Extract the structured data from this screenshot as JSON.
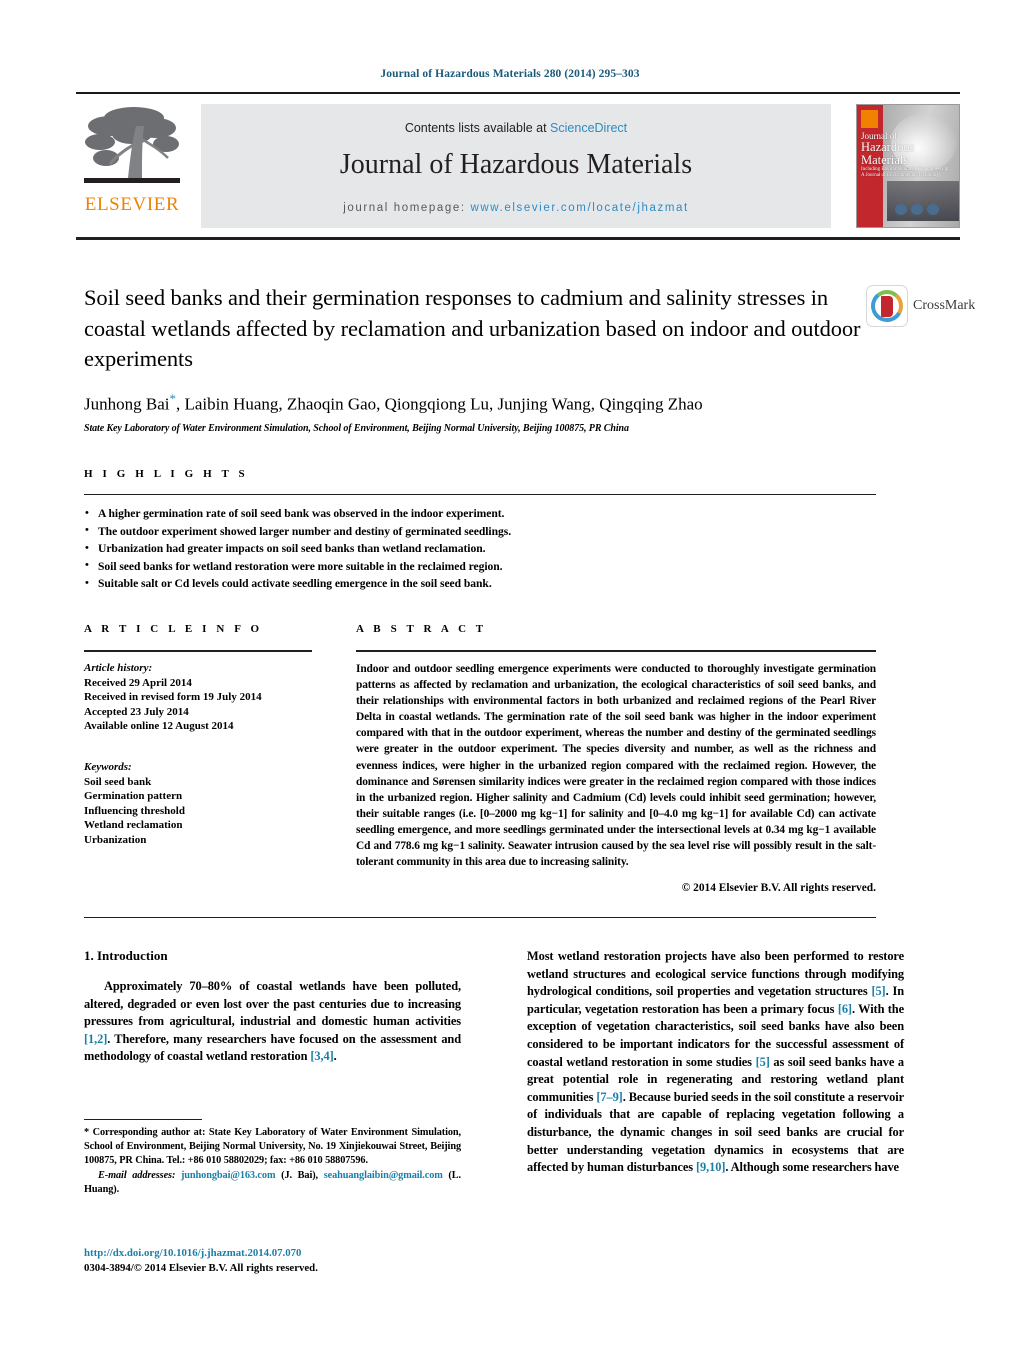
{
  "running_head": "Journal of Hazardous Materials 280 (2014) 295–303",
  "masthead": {
    "contents_prefix": "Contents lists available at ",
    "sciencedirect": "ScienceDirect",
    "journal_title": "Journal of Hazardous Materials",
    "homepage_label": "journal homepage:",
    "homepage_url": "www.elsevier.com/locate/jhazmat",
    "publisher_logo_text": "ELSEVIER",
    "cover_title_line1": "Journal of",
    "cover_title_line2": "Hazardous",
    "cover_title_line3": "Materials",
    "cover_subtitle": "Including Environmental & Bioengineering",
    "cover_subtitle2": "A Journal of Environmental Technology",
    "accent_blue": "#2e8bc4",
    "accent_orange": "#ef8200",
    "band_gray": "#e6e7e8"
  },
  "article": {
    "title": "Soil seed banks and their germination responses to cadmium and salinity stresses in coastal wetlands affected by reclamation and urbanization based on indoor and outdoor experiments",
    "authors": "Junhong Bai",
    "authors_rest": ", Laibin Huang, Zhaoqin Gao, Qiongqiong Lu, Junjing Wang, Qingqing Zhao",
    "corresponding_marker": "*",
    "affiliation": "State Key Laboratory of Water Environment Simulation, School of Environment, Beijing Normal University, Beijing 100875, PR China",
    "crossmark_label": "CrossMark"
  },
  "highlights": {
    "heading": "H I G H L I G H T S",
    "items": [
      "A higher germination rate of soil seed bank was observed in the indoor experiment.",
      "The outdoor experiment showed larger number and destiny of germinated seedlings.",
      "Urbanization had greater impacts on soil seed banks than wetland reclamation.",
      "Soil seed banks for wetland restoration were more suitable in the reclaimed region.",
      "Suitable salt or Cd levels could activate seedling emergence in the soil seed bank."
    ]
  },
  "article_info": {
    "heading": "A R T I C L E    I N F O",
    "history_label": "Article history:",
    "history": [
      "Received 29 April 2014",
      "Received in revised form 19 July 2014",
      "Accepted 23 July 2014",
      "Available online 12 August 2014"
    ],
    "keywords_label": "Keywords:",
    "keywords": [
      "Soil seed bank",
      "Germination pattern",
      "Influencing threshold",
      "Wetland reclamation",
      "Urbanization"
    ]
  },
  "abstract": {
    "heading": "A B S T R A C T",
    "text": "Indoor and outdoor seedling emergence experiments were conducted to thoroughly investigate germination patterns as affected by reclamation and urbanization, the ecological characteristics of soil seed banks, and their relationships with environmental factors in both urbanized and reclaimed regions of the Pearl River Delta in coastal wetlands. The germination rate of the soil seed bank was higher in the indoor experiment compared with that in the outdoor experiment, whereas the number and destiny of the germinated seedlings were greater in the outdoor experiment. The species diversity and number, as well as the richness and evenness indices, were higher in the urbanized region compared with the reclaimed region. However, the dominance and Sørensen similarity indices were greater in the reclaimed region compared with those indices in the urbanized region. Higher salinity and Cadmium (Cd) levels could inhibit seed germination; however, their suitable ranges (i.e. [0–2000 mg kg−1] for salinity and [0–4.0 mg kg−1] for available Cd) can activate seedling emergence, and more seedlings germinated under the intersectional levels at 0.34 mg kg−1 available Cd and 778.6 mg kg−1 salinity. Seawater intrusion caused by the sea level rise will possibly result in the salt-tolerant community in this area due to increasing salinity.",
    "copyright": "© 2014 Elsevier B.V. All rights reserved."
  },
  "intro": {
    "heading": "1.  Introduction",
    "left_para_1_a": "Approximately 70–80% of coastal wetlands have been polluted, altered, degraded or even lost over the past centuries due to increasing pressures from agricultural, industrial and domestic human activities ",
    "left_ref_1": "[1,2]",
    "left_para_1_b": ". Therefore, many researchers have focused on the assessment and methodology of coastal wetland restoration ",
    "left_ref_2": "[3,4]",
    "left_para_1_c": ".",
    "right_para_a": "Most wetland restoration projects have also been performed to restore wetland structures and ecological service functions through modifying hydrological conditions, soil properties and vegetation structures ",
    "right_ref_1": "[5]",
    "right_para_b": ". In particular, vegetation restoration has been a primary focus ",
    "right_ref_2": "[6]",
    "right_para_c": ". With the exception of vegetation characteristics, soil seed banks have also been considered to be important indicators for the successful assessment of coastal wetland restoration in some studies ",
    "right_ref_3": "[5]",
    "right_para_d": " as soil seed banks have a great potential role in regenerating and restoring wetland plant communities ",
    "right_ref_4": "[7–9]",
    "right_para_e": ". Because buried seeds in the soil constitute a reservoir of individuals that are capable of replacing vegetation following a disturbance, the dynamic changes in soil seed banks are crucial for better understanding vegetation dynamics in ecosystems that are affected by human disturbances ",
    "right_ref_5": "[9,10]",
    "right_para_f": ". Although some researchers have"
  },
  "footnote": {
    "corresponding": "*  Corresponding author at: State Key Laboratory of Water Environment Simulation, School of Environment, Beijing Normal University, No. 19 Xinjiekouwai Street, Beijing 100875, PR China. Tel.: +86 010 58802029; fax: +86 010 58807596.",
    "email_label": "E-mail addresses:",
    "email_1": "junhongbai@163.com",
    "email_1_person": "(J. Bai)",
    "email_2": "seahuanglaibin@gmail.com",
    "email_2_person": "(L. Huang).",
    "doi_url": "http://dx.doi.org/10.1016/j.jhazmat.2014.07.070",
    "issn_line": "0304-3894/© 2014 Elsevier B.V. All rights reserved."
  }
}
